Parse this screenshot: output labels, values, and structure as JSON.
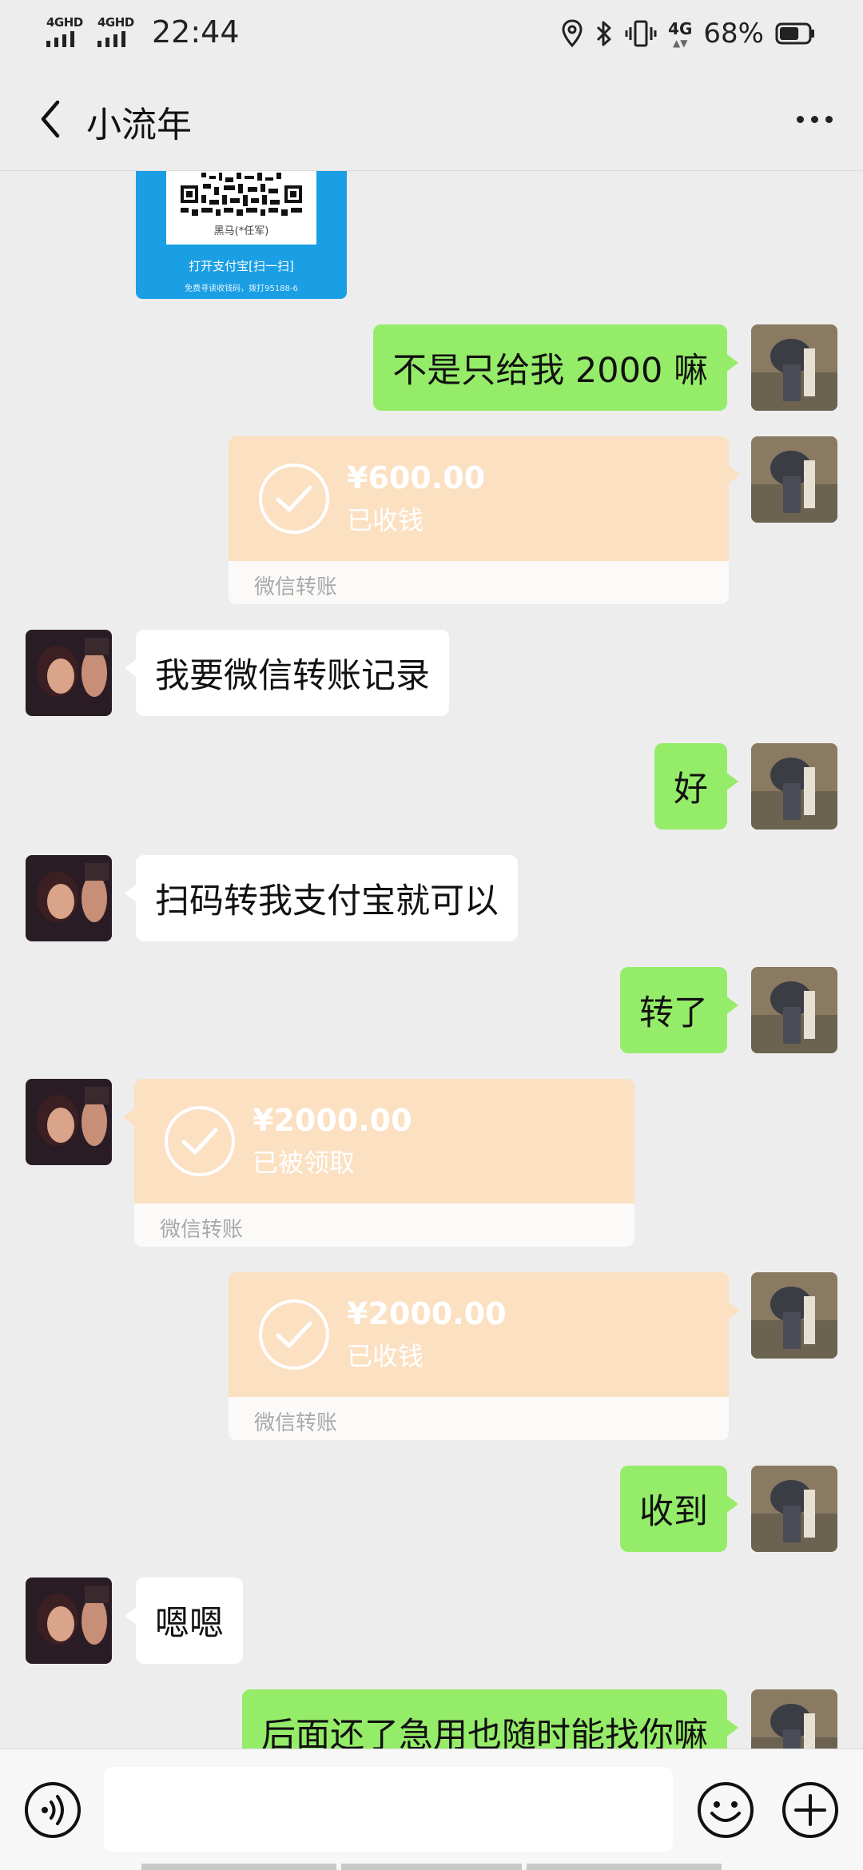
{
  "status_bar": {
    "sim1_label": "4GHD",
    "sim2_label": "4GHD",
    "time": "22:44",
    "net_label": "4G",
    "battery": "68%",
    "battery_level": 0.68,
    "icons": [
      "location-icon",
      "bluetooth-icon",
      "vibrate-icon",
      "network-4g-icon",
      "battery-icon"
    ]
  },
  "header": {
    "title": "小流年",
    "back_icon": "chevron-left-icon",
    "more_icon": "more-dots-icon"
  },
  "qr_card": {
    "name": "黑马(*任军)",
    "open_text": "打开支付宝[扫一扫]",
    "hint": "免费寻读收钱码，拨打95188-6"
  },
  "messages": [
    {
      "side": "me",
      "type": "text",
      "text": "不是只给我 2000 嘛"
    },
    {
      "side": "me",
      "type": "transfer",
      "amount": "¥600.00",
      "status": "已收钱",
      "label": "微信转账"
    },
    {
      "side": "them",
      "type": "text",
      "text": "我要微信转账记录"
    },
    {
      "side": "me",
      "type": "text",
      "text": "好"
    },
    {
      "side": "them",
      "type": "text",
      "text": "扫码转我支付宝就可以"
    },
    {
      "side": "me",
      "type": "text",
      "text": "转了"
    },
    {
      "side": "them",
      "type": "transfer",
      "amount": "¥2000.00",
      "status": "已被领取",
      "label": "微信转账"
    },
    {
      "side": "me",
      "type": "transfer",
      "amount": "¥2000.00",
      "status": "已收钱",
      "label": "微信转账"
    },
    {
      "side": "me",
      "type": "text",
      "text": "收到"
    },
    {
      "side": "them",
      "type": "text",
      "text": "嗯嗯"
    },
    {
      "side": "me",
      "type": "text",
      "text": "后面还了急用也随时能找你嘛"
    }
  ],
  "input_bar": {
    "value": "",
    "icons": [
      "voice-icon",
      "emoji-icon",
      "plus-icon"
    ]
  },
  "colors": {
    "background": "#ededed",
    "my_bubble": "#95ec69",
    "their_bubble": "#ffffff",
    "transfer_card": "#fbe0c2",
    "qr_card": "#1a9ee4"
  }
}
